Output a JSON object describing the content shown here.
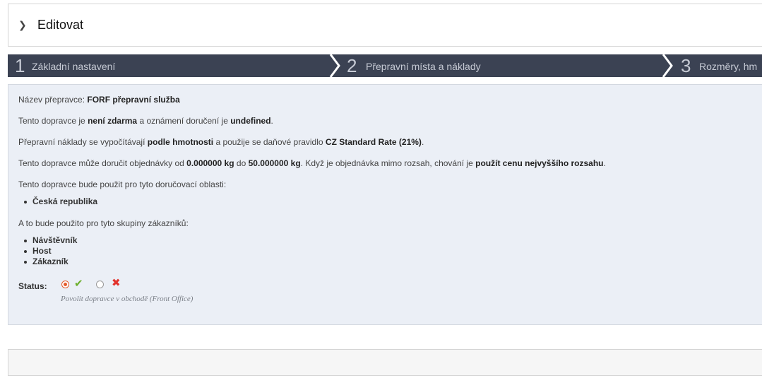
{
  "header": {
    "title": "Editovat",
    "chevron_icon": "chevron-right-icon"
  },
  "steps": [
    {
      "number": "1",
      "label": "Základní nastavení"
    },
    {
      "number": "2",
      "label": "Přepravní místa a náklady"
    },
    {
      "number": "3",
      "label": "Rozměry, hm"
    }
  ],
  "summary": {
    "carrier_name_label": "Název přepravce:",
    "carrier_name": "FORF přepravní služba",
    "line2": {
      "a": "Tento dopravce je",
      "b": "není zdarma",
      "c": "a oznámení doručení je",
      "d": "undefined",
      "e": "."
    },
    "line3": {
      "a": "Přepravní náklady se vypočítávají",
      "b": "podle hmotnosti",
      "c": "a použije se daňové pravidlo",
      "d": "CZ Standard Rate (21%)",
      "e": "."
    },
    "line4": {
      "a": "Tento dopravce může doručit objednávky od",
      "b": "0.000000 kg",
      "c": "do",
      "d": "50.000000 kg",
      "e": ". Když je objednávka mimo rozsah, chování je",
      "f": "použít cenu nejvyššího rozsahu",
      "g": "."
    },
    "zones_intro": "Tento dopravce bude použit pro tyto doručovací oblasti:",
    "zones": [
      "Česká republika"
    ],
    "groups_intro": "A to bude použito pro tyto skupiny zákazníků:",
    "groups": [
      "Návštěvník",
      "Host",
      "Zákazník"
    ]
  },
  "status": {
    "label": "Status:",
    "enabled": true,
    "help": "Povolit dopravce v obchodě (Front Office)",
    "colors": {
      "radio_on": "#e35a2c",
      "check": "#6bae2a",
      "cross": "#e2332d"
    }
  },
  "colors": {
    "step_bar": "#3b4253",
    "content_bg": "#ebeff6"
  }
}
